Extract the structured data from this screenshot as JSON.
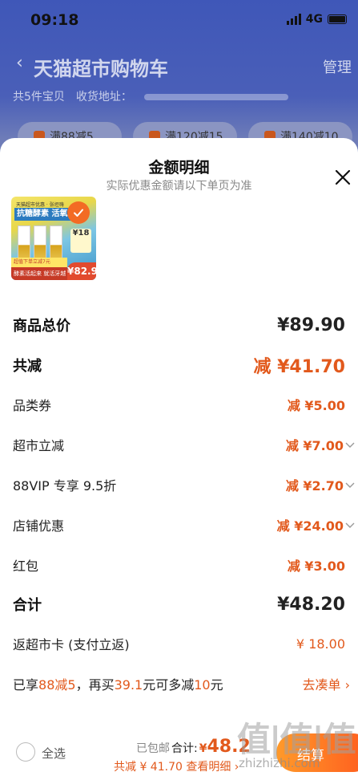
{
  "status": {
    "time": "09:18",
    "network": "4G"
  },
  "nav": {
    "back": "‹",
    "title": "天猫超市购物车",
    "manage": "管理"
  },
  "subinfo": {
    "count": "共5件宝贝",
    "address_label": "收货地址："
  },
  "coupons": [
    "满88减5",
    "满120减15",
    "满140减10"
  ],
  "sheet": {
    "title": "金额明细",
    "subtitle": "实际优惠金额请以下单页为准"
  },
  "thumb": {
    "top_text": "天猫超市优惠 · 张坦嗨",
    "headline": "抗糖酵素 活氧",
    "badge": "¥18",
    "band": "超值下单立减7元",
    "bottom_text": "酵素活起来 就活牙越白",
    "price": "¥82.9"
  },
  "rows": [
    {
      "label": "商品总价",
      "value": "¥89.90",
      "style": "total"
    },
    {
      "label": "共减",
      "value": "减 ¥41.70",
      "style": "reduce"
    },
    {
      "label": "品类券",
      "value": "减 ¥5.00"
    },
    {
      "label": "超市立减",
      "value": "减 ¥7.00",
      "chevron": true
    },
    {
      "label": "88VIP 专享 9.5折",
      "value": "减 ¥2.70",
      "chevron": true
    },
    {
      "label": "店铺优惠",
      "value": "减 ¥24.00",
      "chevron": true
    },
    {
      "label": "红包",
      "value": "减 ¥3.00"
    },
    {
      "label": "合计",
      "value": "¥48.20",
      "style": "total"
    },
    {
      "label": "返超市卡 (支付立返)",
      "value": "¥ 18.00",
      "style": "plain"
    }
  ],
  "promo": {
    "p1": "已享",
    "p2": "88减5",
    "p3": "，再买",
    "p4": "39.1",
    "p5": "元可多减",
    "p6": "10",
    "p7": "元",
    "action": "去凑单 ›"
  },
  "bottom": {
    "select_all": "全选",
    "shipping": "已包邮",
    "total_label": "合计:",
    "yen": "¥",
    "amount": "48.2",
    "reduce_text": "共减 ¥ 41.70  查看明细 ›",
    "checkout": "结算"
  },
  "watermark": {
    "logo": "值|值|值",
    "url": "zhizhizhi.com"
  },
  "colors": {
    "accent": "#e2591c",
    "sheet_bg": "#ffffff",
    "page_bg": "#4a5fb8"
  }
}
